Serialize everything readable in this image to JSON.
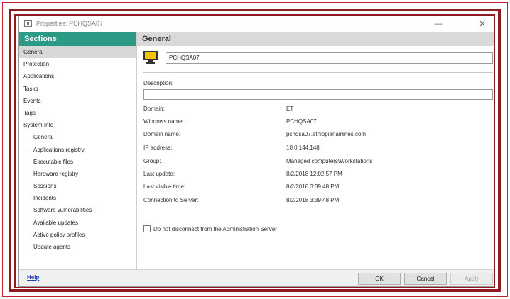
{
  "window": {
    "title": "Properties: PCHQSA07"
  },
  "sidebar": {
    "header": "Sections",
    "items": [
      {
        "label": "General"
      },
      {
        "label": "Protection"
      },
      {
        "label": "Applications"
      },
      {
        "label": "Tasks"
      },
      {
        "label": "Events"
      },
      {
        "label": "Tags"
      },
      {
        "label": "System Info"
      },
      {
        "label": "General"
      },
      {
        "label": "Applications registry"
      },
      {
        "label": "Executable files"
      },
      {
        "label": "Hardware registry"
      },
      {
        "label": "Sessions"
      },
      {
        "label": "Incidents"
      },
      {
        "label": "Software vulnerabilities"
      },
      {
        "label": "Available updates"
      },
      {
        "label": "Active policy profiles"
      },
      {
        "label": "Update agents"
      }
    ]
  },
  "main": {
    "header": "General",
    "device_name": "PCHQSA07",
    "description_label": "Description:",
    "description_value": "",
    "fields": [
      {
        "label": "Domain:",
        "value": "ET"
      },
      {
        "label": "Windows name:",
        "value": "PCHQSA07"
      },
      {
        "label": "Domain name:",
        "value": "pchqsa07.ethiopianairlines.com"
      },
      {
        "label": "IP address:",
        "value": "10.0.144.148"
      },
      {
        "label": "Group:",
        "value": "Managed computers\\Workstations"
      },
      {
        "label": "Last update:",
        "value": "8/2/2018 12:02:57 PM"
      },
      {
        "label": "Last visible time:",
        "value": "8/2/2018 3:39:48 PM"
      },
      {
        "label": "Connection to Server:",
        "value": "8/2/2018 3:39:48 PM"
      }
    ],
    "checkbox_label": "Do not disconnect from the Administration Server"
  },
  "footer": {
    "help": "Help",
    "ok": "OK",
    "cancel": "Cancel",
    "apply": "Apply"
  },
  "colors": {
    "accent": "#2d9a86",
    "frame": "#8e1a22"
  }
}
